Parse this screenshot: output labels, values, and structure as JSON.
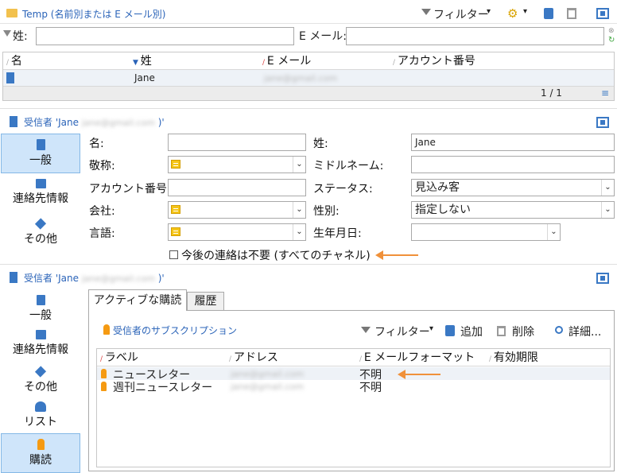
{
  "top_panel": {
    "title": "Temp (名前別または E メール別)",
    "filter_label": "フィルター",
    "last_name_label": "姓:",
    "email_label": "E メール:",
    "columns": [
      "名",
      "姓",
      "E メール",
      "アカウント番号"
    ],
    "row": {
      "first": "",
      "last": "Jane",
      "email": "jane@gmail.com",
      "account": ""
    },
    "pager": "1 / 1"
  },
  "recipient_panel": {
    "title_prefix": "受信者 'Jane",
    "title_email": "jane@gmail.com",
    "title_suffix": ")'",
    "sidebar": [
      "一般",
      "連絡先情報",
      "その他"
    ],
    "form": {
      "first_name_label": "名:",
      "last_name_label": "姓:",
      "last_name_value": "Jane",
      "salutation_label": "敬称:",
      "middle_name_label": "ミドルネーム:",
      "account_label": "アカウント番号:",
      "status_label": "ステータス:",
      "status_value": "見込み客",
      "company_label": "会社:",
      "gender_label": "性別:",
      "gender_value": "指定しない",
      "language_label": "言語:",
      "birth_label": "生年月日:",
      "no_contact_label": "今後の連絡は不要 (すべてのチャネル)"
    }
  },
  "subscription_panel": {
    "title_prefix": "受信者 'Jane",
    "title_email": "jane@gmail.com",
    "title_suffix": ")'",
    "sidebar": [
      "一般",
      "連絡先情報",
      "その他",
      "リスト",
      "購読"
    ],
    "tabs": [
      "アクティブな購読",
      "履歴"
    ],
    "toolbar_title": "受信者のサブスクリプション",
    "filter_label": "フィルター",
    "add_label": "追加",
    "delete_label": "削除",
    "detail_label": "詳細...",
    "columns": [
      "ラベル",
      "アドレス",
      "E メールフォーマット",
      "有効期限"
    ],
    "rows": [
      {
        "label": "ニュースレター",
        "address": "jane@gmail.com",
        "format": "不明",
        "expiry": ""
      },
      {
        "label": "週刊ニュースレター",
        "address": "jane@gmail.com",
        "format": "不明",
        "expiry": ""
      }
    ]
  },
  "colors": {
    "accent": "#2a63b8",
    "arrow": "#f0913a",
    "selected": "#cfe5fa"
  }
}
